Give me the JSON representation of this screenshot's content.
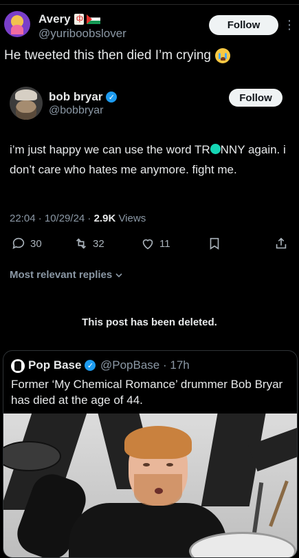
{
  "outer_post": {
    "author_name": "Avery",
    "author_handle": "@yuriboobslover",
    "follow_label": "Follow",
    "more_label": "⋮",
    "caption": "He tweeted this then died I’m crying"
  },
  "screenshot_post": {
    "author_name": "bob bryar",
    "author_handle": "@bobbryar",
    "follow_label": "Follow",
    "text_part1": "i’m just happy we can use the word TR",
    "text_part2": "NNY again. i don’t care who hates me anymore. fight me.",
    "timestamp": "22:04 · 10/29/24 · ",
    "views_count": "2.9K",
    "views_label": " Views",
    "actions": {
      "replies": "30",
      "reposts": "32",
      "likes": "11"
    },
    "replies_sort_label": "Most relevant replies",
    "deleted_notice": "This post has been deleted."
  },
  "quoted_post": {
    "author_name": "Pop Base",
    "author_handle_time": "@PopBase · 17h",
    "text": "Former ‘My Chemical Romance’ drummer Bob Bryar has died at the age of 44."
  },
  "colors": {
    "background": "#000000",
    "text_primary": "#e7e9ea",
    "text_secondary": "#8b98a5",
    "verified_blue": "#1d9bf0",
    "redaction_blot": "#15d6b5"
  }
}
